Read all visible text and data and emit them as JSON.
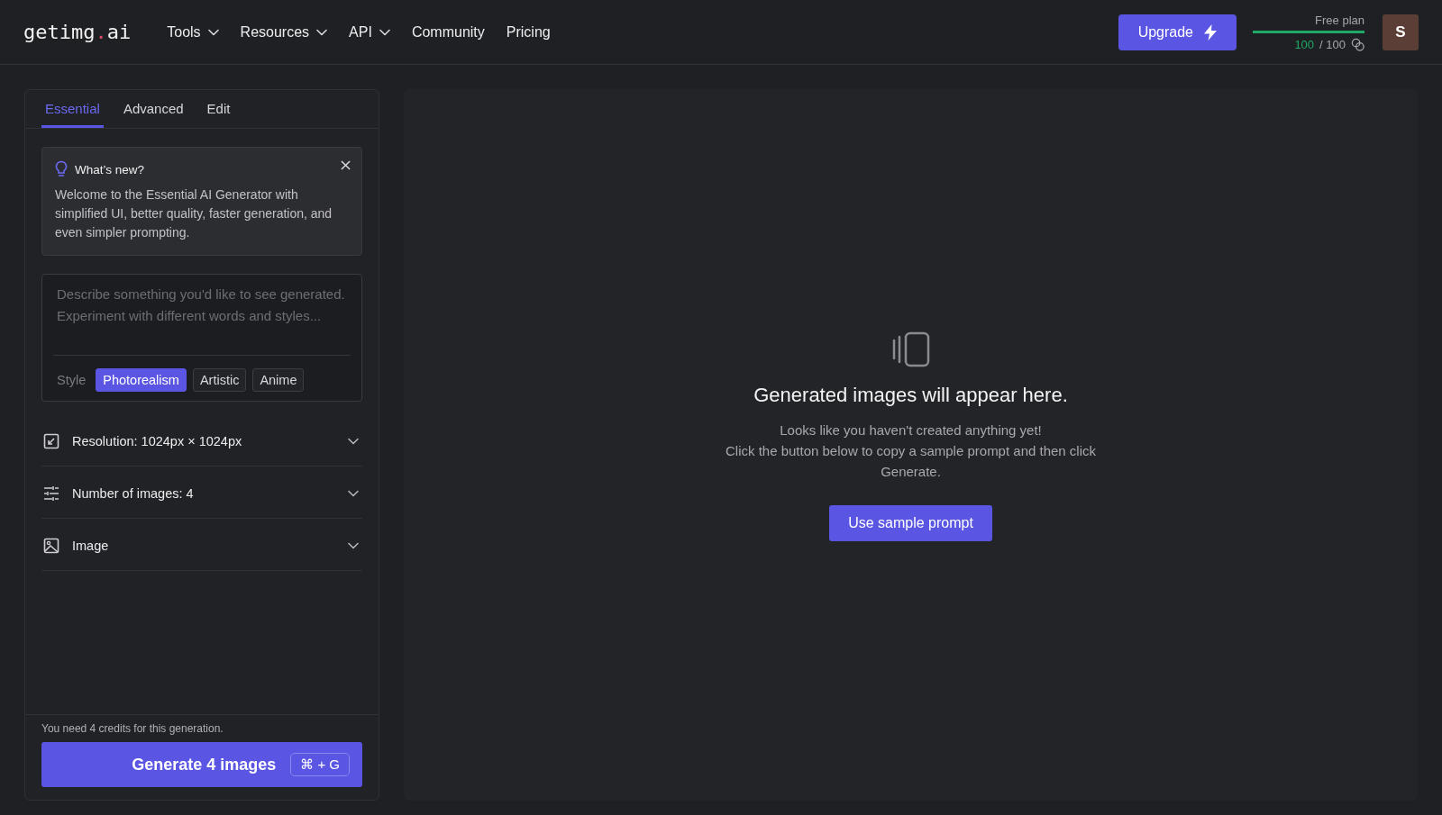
{
  "header": {
    "logo": {
      "text": "getimg",
      "accent": ".",
      "suffix": "ai"
    },
    "nav": [
      {
        "label": "Tools",
        "has_menu": true
      },
      {
        "label": "Resources",
        "has_menu": true
      },
      {
        "label": "API",
        "has_menu": true
      },
      {
        "label": "Community",
        "has_menu": false
      },
      {
        "label": "Pricing",
        "has_menu": false
      }
    ],
    "upgrade_button": "Upgrade",
    "plan": {
      "name": "Free plan",
      "level": 1,
      "credits_left": "100",
      "credits_total": "/ 100"
    },
    "avatar": "S"
  },
  "sidebar": {
    "tabs": [
      {
        "label": "Essential",
        "selected": true
      },
      {
        "label": "Advanced",
        "selected": false
      },
      {
        "label": "Edit",
        "selected": false
      }
    ],
    "notice": {
      "title": "What’s new?",
      "body": "Welcome to the Essential AI Generator with simplified UI, better quality, faster generation, and even simpler prompting."
    },
    "prompt": {
      "placeholder": "Describe something you'd like to see generated. Experiment with different words and styles...",
      "style_label": "Style",
      "styles": [
        {
          "label": "Photorealism",
          "selected": true
        },
        {
          "label": "Artistic",
          "selected": false
        },
        {
          "label": "Anime",
          "selected": false
        }
      ]
    },
    "settings": [
      {
        "kind": "resize",
        "label": "Resolution: 1024px × 1024px",
        "expanded": false
      },
      {
        "kind": "sliders",
        "label": "Number of images: 4",
        "expanded": false
      },
      {
        "kind": "image",
        "label": "Image",
        "expanded": false
      }
    ],
    "credits_note": "You need 4 credits for this generation.",
    "generate_button": {
      "label": "Generate 4 images",
      "shortcut": "⌘ + G"
    }
  },
  "empty_state": {
    "title": "Generated images will appear here.",
    "lines": [
      "Looks like you haven't created anything yet!",
      "Click the button below to copy a sample prompt and then click Generate."
    ],
    "button": "Use sample prompt"
  }
}
